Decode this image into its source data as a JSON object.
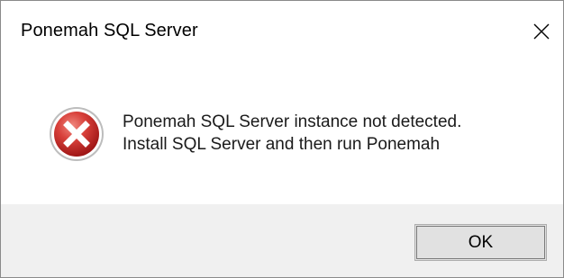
{
  "window": {
    "title": "Ponemah SQL Server"
  },
  "message": {
    "line1": "Ponemah SQL Server instance not detected.",
    "line2": "Install SQL Server and then run Ponemah",
    "icon": "error-icon"
  },
  "buttons": {
    "ok_label": "OK"
  },
  "colors": {
    "error_red": "#d0312d",
    "footer_bg": "#f0f0f0",
    "button_bg": "#e1e1e1"
  }
}
